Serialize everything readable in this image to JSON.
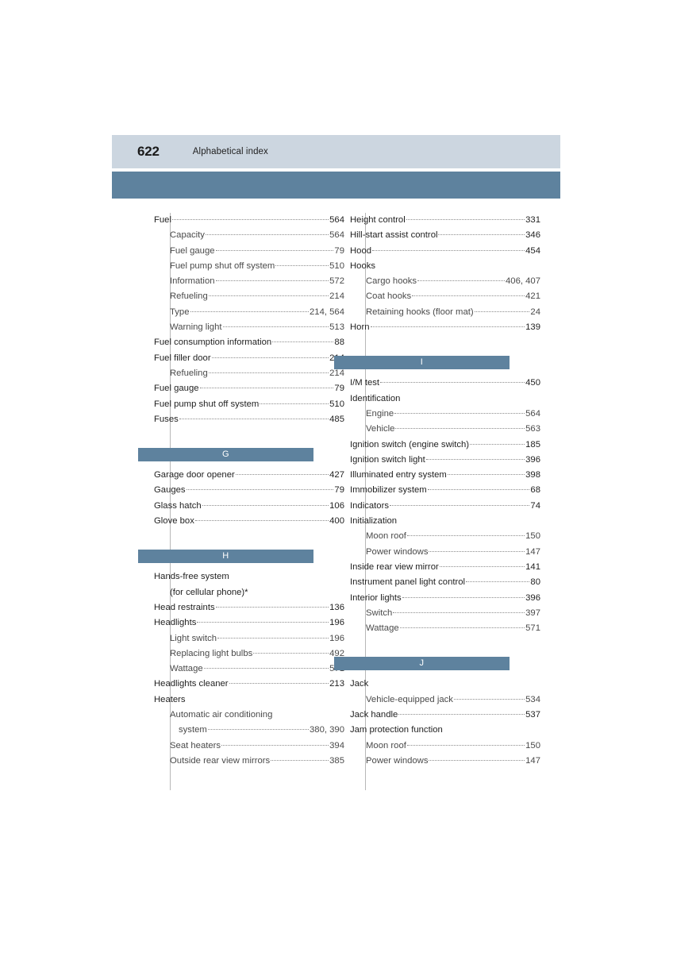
{
  "header": {
    "page_number": "622",
    "title": "Alphabetical index",
    "band_color": "#ccd6e0",
    "rule_color": "#5e829e"
  },
  "columns": {
    "left": {
      "blocks": [
        {
          "type": "entries",
          "entries": [
            {
              "label": "Fuel",
              "page": "564",
              "level": 0
            },
            {
              "label": "Capacity",
              "page": "564",
              "level": 1
            },
            {
              "label": "Fuel gauge",
              "page": "79",
              "level": 1
            },
            {
              "label": "Fuel pump shut off system",
              "page": "510",
              "level": 1
            },
            {
              "label": "Information",
              "page": "572",
              "level": 1
            },
            {
              "label": "Refueling",
              "page": "214",
              "level": 1
            },
            {
              "label": "Type",
              "page": "214, 564",
              "level": 1
            },
            {
              "label": "Warning light",
              "page": "513",
              "level": 1
            },
            {
              "label": "Fuel consumption information",
              "page": "88",
              "level": 0
            },
            {
              "label": "Fuel filler door",
              "page": "214",
              "level": 0
            },
            {
              "label": "Refueling",
              "page": "214",
              "level": 1
            },
            {
              "label": "Fuel gauge",
              "page": "79",
              "level": 0
            },
            {
              "label": "Fuel pump shut off system",
              "page": "510",
              "level": 0
            },
            {
              "label": "Fuses",
              "page": "485",
              "level": 0
            }
          ]
        },
        {
          "type": "letter",
          "letter": "G"
        },
        {
          "type": "entries",
          "entries": [
            {
              "label": "Garage door opener",
              "page": "427",
              "level": 0
            },
            {
              "label": "Gauges",
              "page": "79",
              "level": 0
            },
            {
              "label": "Glass hatch",
              "page": "106",
              "level": 0
            },
            {
              "label": "Glove box",
              "page": "400",
              "level": 0
            }
          ]
        },
        {
          "type": "letter",
          "letter": "H"
        },
        {
          "type": "entries",
          "entries": [
            {
              "label": "Hands-free system",
              "page": "",
              "level": 0,
              "no_page": true
            },
            {
              "label": "(for cellular phone)*",
              "page": "",
              "level": 0,
              "no_page": true,
              "continuation": true
            },
            {
              "label": "Head restraints",
              "page": "136",
              "level": 0
            },
            {
              "label": "Headlights",
              "page": "196",
              "level": 0
            },
            {
              "label": "Light switch",
              "page": "196",
              "level": 1
            },
            {
              "label": "Replacing light bulbs",
              "page": "492",
              "level": 1
            },
            {
              "label": "Wattage",
              "page": "571",
              "level": 1
            },
            {
              "label": "Headlights cleaner",
              "page": "213",
              "level": 0
            },
            {
              "label": "Heaters",
              "page": "",
              "level": 0,
              "no_page": true
            },
            {
              "label": "Automatic air conditioning",
              "page": "",
              "level": 1,
              "no_page": true
            },
            {
              "label": "system",
              "page": "380, 390",
              "level": 2
            },
            {
              "label": "Seat heaters",
              "page": "394",
              "level": 1
            },
            {
              "label": "Outside rear view mirrors",
              "page": "385",
              "level": 1
            }
          ]
        }
      ]
    },
    "right": {
      "blocks": [
        {
          "type": "entries",
          "entries": [
            {
              "label": "Height control",
              "page": "331",
              "level": 0
            },
            {
              "label": "Hill-start assist control",
              "page": "346",
              "level": 0
            },
            {
              "label": "Hood",
              "page": "454",
              "level": 0
            },
            {
              "label": "Hooks",
              "page": "",
              "level": 0,
              "no_page": true
            },
            {
              "label": "Cargo hooks",
              "page": "406, 407",
              "level": 1
            },
            {
              "label": "Coat hooks",
              "page": "421",
              "level": 1
            },
            {
              "label": "Retaining hooks (floor mat)",
              "page": "24",
              "level": 1
            },
            {
              "label": "Horn",
              "page": "139",
              "level": 0
            }
          ]
        },
        {
          "type": "letter",
          "letter": "I"
        },
        {
          "type": "entries",
          "entries": [
            {
              "label": "I/M test",
              "page": "450",
              "level": 0
            },
            {
              "label": "Identification",
              "page": "",
              "level": 0,
              "no_page": true
            },
            {
              "label": "Engine",
              "page": "564",
              "level": 1
            },
            {
              "label": "Vehicle",
              "page": "563",
              "level": 1
            },
            {
              "label": "Ignition switch (engine switch)",
              "page": "185",
              "level": 0
            },
            {
              "label": "Ignition switch light",
              "page": "396",
              "level": 0
            },
            {
              "label": "Illuminated entry system",
              "page": "398",
              "level": 0
            },
            {
              "label": "Immobilizer system",
              "page": "68",
              "level": 0
            },
            {
              "label": "Indicators",
              "page": "74",
              "level": 0
            },
            {
              "label": "Initialization",
              "page": "",
              "level": 0,
              "no_page": true
            },
            {
              "label": "Moon roof",
              "page": "150",
              "level": 1
            },
            {
              "label": "Power windows",
              "page": "147",
              "level": 1
            },
            {
              "label": "Inside rear view mirror",
              "page": "141",
              "level": 0
            },
            {
              "label": "Instrument panel light control",
              "page": "80",
              "level": 0
            },
            {
              "label": "Interior lights",
              "page": "396",
              "level": 0
            },
            {
              "label": "Switch",
              "page": "397",
              "level": 1
            },
            {
              "label": "Wattage",
              "page": "571",
              "level": 1
            }
          ]
        },
        {
          "type": "letter",
          "letter": "J"
        },
        {
          "type": "entries",
          "entries": [
            {
              "label": "Jack",
              "page": "",
              "level": 0,
              "no_page": true
            },
            {
              "label": "Vehicle-equipped jack",
              "page": "534",
              "level": 1
            },
            {
              "label": "Jack handle",
              "page": "537",
              "level": 0
            },
            {
              "label": "Jam protection function",
              "page": "",
              "level": 0,
              "no_page": true
            },
            {
              "label": "Moon roof",
              "page": "150",
              "level": 1
            },
            {
              "label": "Power windows",
              "page": "147",
              "level": 1
            }
          ]
        }
      ]
    }
  }
}
